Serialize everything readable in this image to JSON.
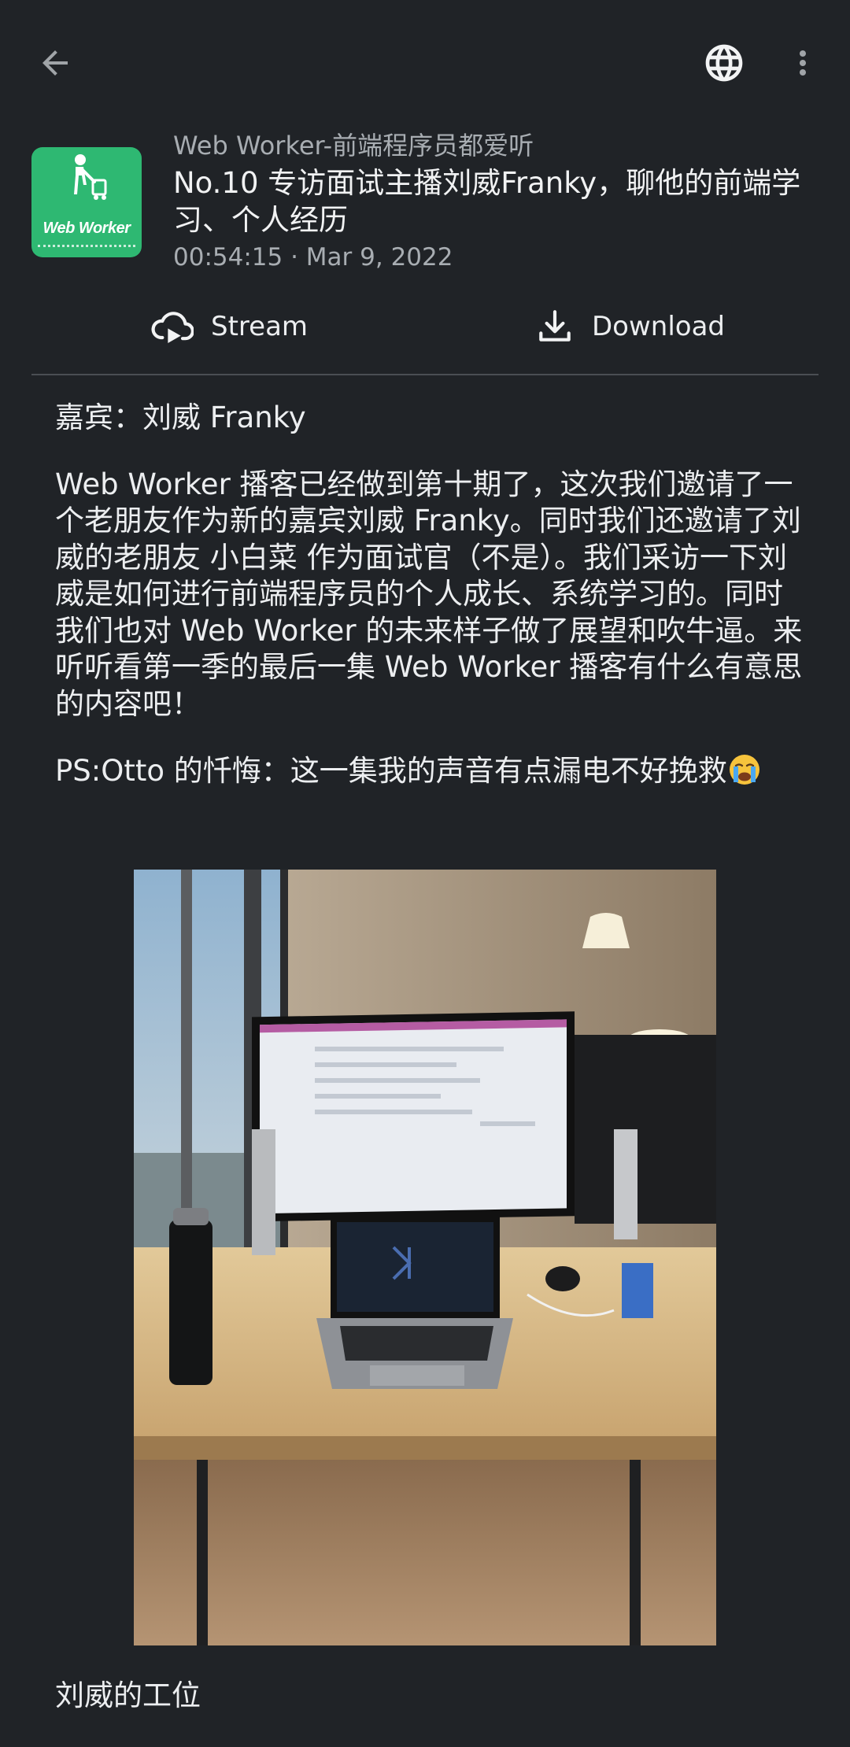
{
  "toolbar": {
    "back_icon": "arrow-left-icon",
    "web_icon": "globe-icon",
    "menu_icon": "more-vert-icon"
  },
  "episode": {
    "podcast_name": "Web Worker-前端程序员都爱听",
    "title": "No.10 专访面试主播刘威Franky，聊他的前端学习、个人经历",
    "duration_date": "00:54:15 · Mar 9, 2022",
    "artwork": {
      "logo_text": "Web Worker",
      "icon": "person-with-cart-icon",
      "bg_color": "#2eb872"
    }
  },
  "actions": {
    "stream_label": "Stream",
    "stream_icon": "cloud-play-icon",
    "download_label": "Download",
    "download_icon": "download-icon"
  },
  "notes": {
    "guest": "嘉宾：刘威 Franky",
    "description": "Web Worker 播客已经做到第十期了，这次我们邀请了一个老朋友作为新的嘉宾刘威 Franky。同时我们还邀请了刘威的老朋友 小白菜 作为面试官（不是）。我们采访一下刘威是如何进行前端程序员的个人成长、系统学习的。同时我们也对 Web Worker 的未来样子做了展望和吹牛逼。来听听看第一季的最后一集 Web Worker 播客有什么有意思的内容吧！",
    "ps": "PS:Otto 的忏悔：这一集我的声音有点漏电不好挽救",
    "ps_emoji": "loudly-crying-face-emoji",
    "image_caption": "刘威的工位"
  },
  "colors": {
    "background": "#202327",
    "text": "#eceef0",
    "muted_text": "#a8adb2",
    "divider": "#4a4e53",
    "accent_green": "#2eb872"
  }
}
